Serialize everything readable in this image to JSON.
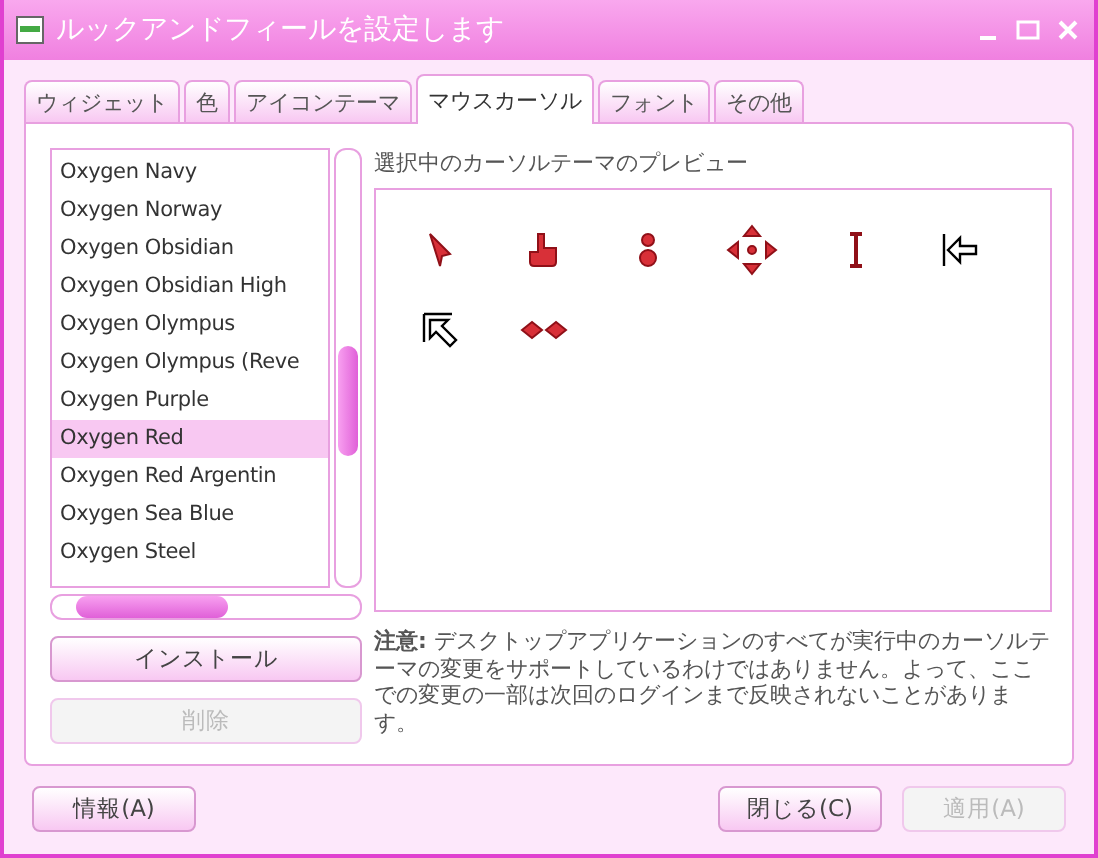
{
  "window": {
    "title": "ルックアンドフィールを設定します"
  },
  "tabs": [
    {
      "label": "ウィジェット",
      "selected": false
    },
    {
      "label": "色",
      "selected": false
    },
    {
      "label": "アイコンテーマ",
      "selected": false
    },
    {
      "label": "マウスカーソル",
      "selected": true
    },
    {
      "label": "フォント",
      "selected": false
    },
    {
      "label": "その他",
      "selected": false
    }
  ],
  "themes": [
    {
      "label": "Oxygen Navy",
      "selected": false
    },
    {
      "label": "Oxygen Norway",
      "selected": false
    },
    {
      "label": "Oxygen Obsidian",
      "selected": false
    },
    {
      "label": "Oxygen Obsidian High",
      "selected": false
    },
    {
      "label": "Oxygen Olympus",
      "selected": false
    },
    {
      "label": "Oxygen Olympus (Reve",
      "selected": false
    },
    {
      "label": "Oxygen Purple",
      "selected": false
    },
    {
      "label": "Oxygen Red",
      "selected": true
    },
    {
      "label": "Oxygen Red Argentin",
      "selected": false
    },
    {
      "label": "Oxygen Sea Blue",
      "selected": false
    },
    {
      "label": "Oxygen Steel",
      "selected": false
    }
  ],
  "install_button": {
    "label": "インストール",
    "disabled": false
  },
  "delete_button": {
    "label": "削除",
    "disabled": true
  },
  "preview": {
    "label": "選択中のカーソルテーマのプレビュー"
  },
  "note": "**注意:** デスクトップアプリケーションのすべてが実行中のカーソルテーマの変更をサポートしているわけではありません。よって、ここでの変更の一部は次回のログインまで反映されないことがあります。",
  "buttons": [
    {
      "label": "情報(A)",
      "disabled": false
    },
    {
      "label": "閉じる(C)",
      "disabled": false
    },
    {
      "label": "適用(A)",
      "disabled": true
    }
  ]
}
